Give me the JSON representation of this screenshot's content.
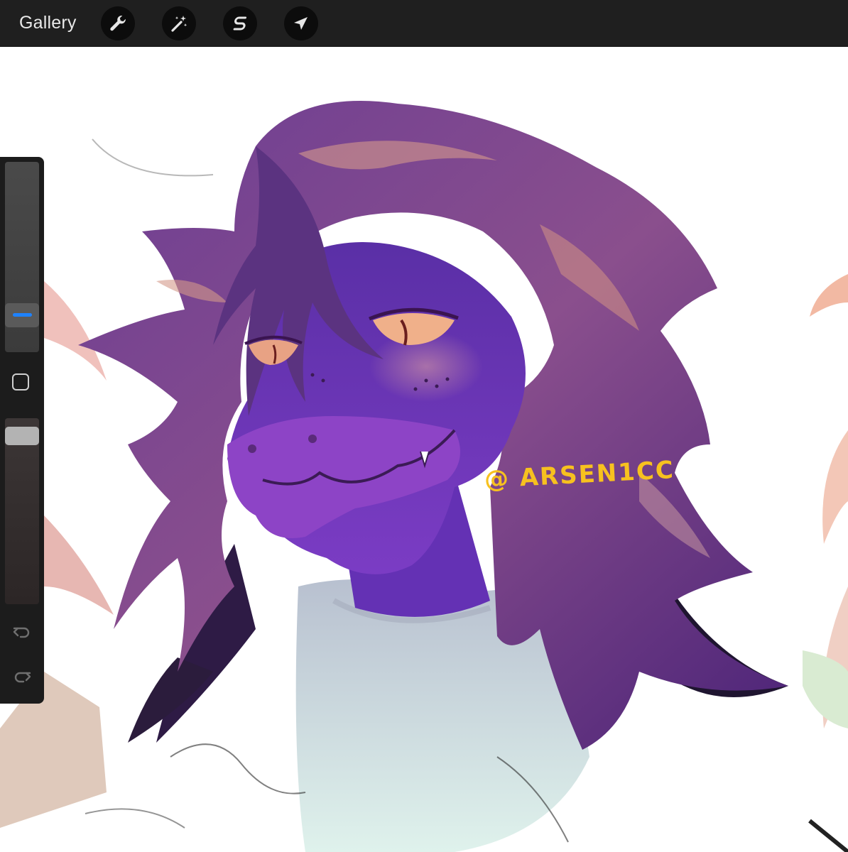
{
  "toolbar": {
    "gallery_label": "Gallery",
    "tools": [
      {
        "name": "wrench-icon",
        "label": "Actions"
      },
      {
        "name": "magic-wand-icon",
        "label": "Adjustments"
      },
      {
        "name": "selection-icon",
        "label": "Selection"
      },
      {
        "name": "transform-arrow-icon",
        "label": "Transform"
      }
    ]
  },
  "canvas": {
    "watermark": "@ ARSEN1CC"
  },
  "sidebar": {
    "brush_size_level": 0.15,
    "opacity_level": 0.95,
    "icons": [
      "modify-square-icon",
      "undo-icon",
      "redo-icon"
    ]
  },
  "colors": {
    "toolbar_bg": "#1f1f1f",
    "accent": "#1e82ff",
    "watermark": "#f7c11f",
    "character_purple": "#7a3fb0"
  }
}
